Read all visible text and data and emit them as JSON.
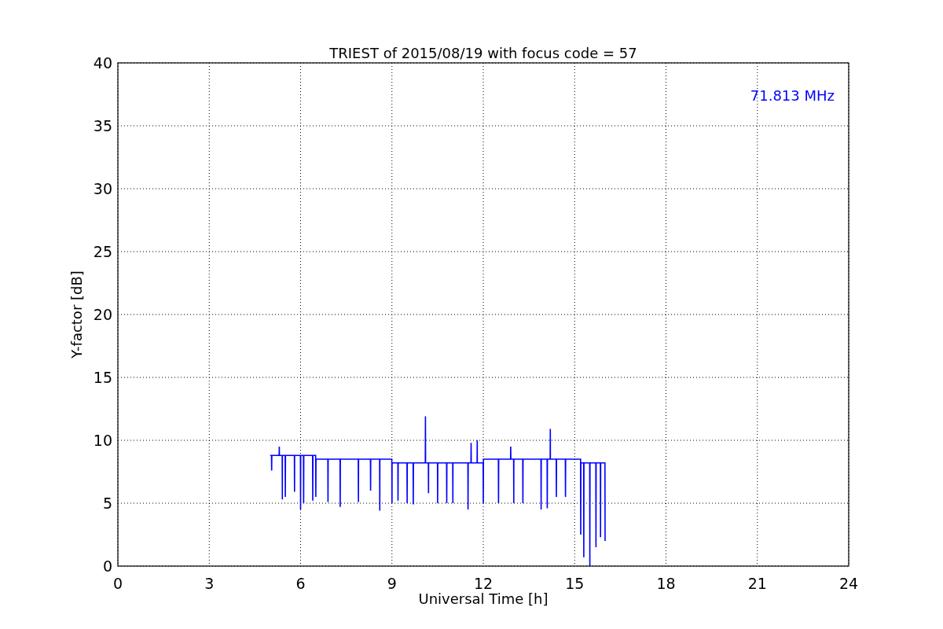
{
  "chart_data": {
    "type": "line",
    "title": "TRIEST of 2015/08/19 with focus code = 57",
    "xlabel": "Universal Time [h]",
    "ylabel": "Y-factor [dB]",
    "xlim": [
      0,
      24
    ],
    "ylim": [
      0,
      40
    ],
    "xticks": [
      0,
      3,
      6,
      9,
      12,
      15,
      18,
      21,
      24
    ],
    "yticks": [
      0,
      5,
      10,
      15,
      20,
      25,
      30,
      35,
      40
    ],
    "grid": true,
    "x": [
      5.0,
      5.045,
      5.05,
      5.055,
      5.295,
      5.3,
      5.305,
      5.395,
      5.4,
      5.405,
      5.495,
      5.5,
      5.505,
      5.795,
      5.8,
      5.805,
      5.995,
      6.0,
      6.005,
      6.095,
      6.1,
      6.105,
      6.395,
      6.4,
      6.405,
      6.495,
      6.5,
      6.505,
      6.895,
      6.9,
      6.905,
      7.295,
      7.3,
      7.305,
      7.895,
      7.9,
      7.905,
      8.295,
      8.3,
      8.305,
      8.595,
      8.6,
      8.605,
      8.995,
      9.0,
      9.005,
      9.195,
      9.2,
      9.205,
      9.495,
      9.5,
      9.505,
      9.695,
      9.7,
      9.705,
      10.095,
      10.1,
      10.105,
      10.195,
      10.2,
      10.205,
      10.495,
      10.5,
      10.505,
      10.795,
      10.8,
      10.805,
      10.995,
      11.0,
      11.005,
      11.495,
      11.5,
      11.505,
      11.595,
      11.6,
      11.605,
      11.795,
      11.8,
      11.805,
      11.995,
      12.0,
      12.005,
      12.495,
      12.5,
      12.505,
      12.895,
      12.9,
      12.905,
      12.995,
      13.0,
      13.005,
      13.295,
      13.3,
      13.305,
      13.895,
      13.9,
      13.905,
      14.095,
      14.1,
      14.105,
      14.195,
      14.2,
      14.205,
      14.395,
      14.4,
      14.405,
      14.695,
      14.7,
      14.705,
      15.195,
      15.2,
      15.205,
      15.295,
      15.3,
      15.305,
      15.495,
      15.5,
      15.505,
      15.695,
      15.7,
      15.705,
      15.845,
      15.85,
      15.855,
      15.995,
      16.0
    ],
    "series": [
      {
        "name": "71.813 MHz",
        "color": "#0000ff",
        "values": [
          8.8,
          8.8,
          7.6,
          8.8,
          8.8,
          9.5,
          8.8,
          8.8,
          5.3,
          8.8,
          8.8,
          5.5,
          8.8,
          8.8,
          5.9,
          8.8,
          8.8,
          4.5,
          8.8,
          8.8,
          5.0,
          8.8,
          8.8,
          5.2,
          8.8,
          8.8,
          5.5,
          8.5,
          8.5,
          5.1,
          8.5,
          8.5,
          4.7,
          8.5,
          8.5,
          5.1,
          8.5,
          8.5,
          6.0,
          8.5,
          8.5,
          4.4,
          8.5,
          8.5,
          5.0,
          8.2,
          8.2,
          5.2,
          8.2,
          8.2,
          5.0,
          8.2,
          8.2,
          4.9,
          8.2,
          8.2,
          11.9,
          8.2,
          8.2,
          5.8,
          8.2,
          8.2,
          5.0,
          8.2,
          8.2,
          5.0,
          8.2,
          8.2,
          5.0,
          8.2,
          8.2,
          4.5,
          8.2,
          8.2,
          9.8,
          8.2,
          8.2,
          10.0,
          8.2,
          8.2,
          5.0,
          8.5,
          8.5,
          5.0,
          8.5,
          8.5,
          9.5,
          8.5,
          8.5,
          5.0,
          8.5,
          8.5,
          5.0,
          8.5,
          8.5,
          4.5,
          8.5,
          8.5,
          4.6,
          8.5,
          8.5,
          10.9,
          8.5,
          8.5,
          5.5,
          8.5,
          8.5,
          5.5,
          8.5,
          8.5,
          2.5,
          8.2,
          8.2,
          0.7,
          8.2,
          8.2,
          0.0,
          8.2,
          8.2,
          1.5,
          8.2,
          8.2,
          2.3,
          8.2,
          8.2,
          2.0
        ]
      }
    ]
  }
}
